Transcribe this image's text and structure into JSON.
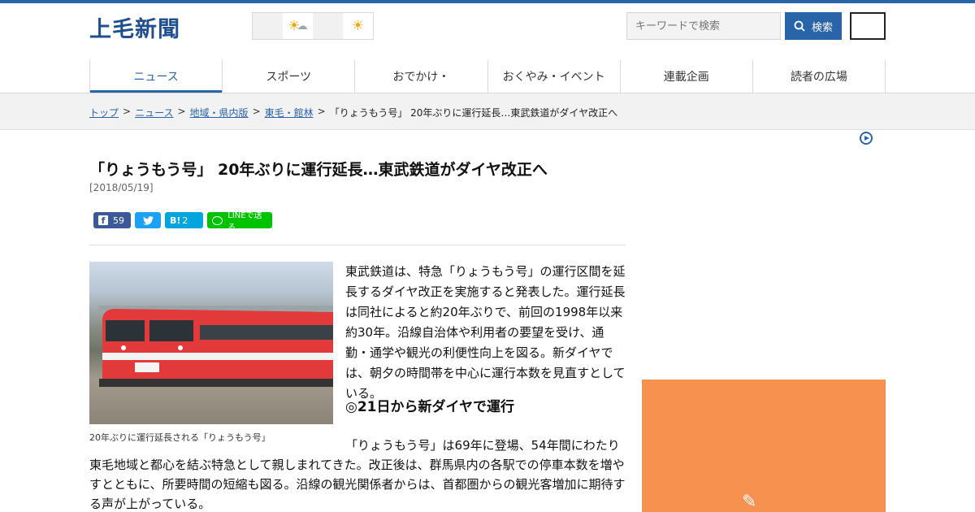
{
  "header": {
    "logo": "上毛新聞",
    "search_placeholder": "キーワードで検索",
    "search_label": "検索"
  },
  "weather": {
    "today_icon": "sun-cloud-icon",
    "tomorrow_icon": "sun-icon"
  },
  "nav": [
    {
      "label": "ニュース",
      "active": true
    },
    {
      "label": "スポーツ",
      "active": false
    },
    {
      "label": "おでかけ・",
      "active": false
    },
    {
      "label": "おくやみ・イベント",
      "active": false
    },
    {
      "label": "連載企画",
      "active": false
    },
    {
      "label": "読者の広場",
      "active": false
    }
  ],
  "breadcrumb": {
    "items": [
      "トップ",
      "ニュース",
      "地域・県内版",
      "東毛・館林"
    ],
    "current": "「りょうもう号」 20年ぶりに運行延長…東武鉄道がダイヤ改正へ"
  },
  "article": {
    "title": "「りょうもう号」 20年ぶりに運行延長…東武鉄道がダイヤ改正へ",
    "date": "[2018/05/19]",
    "share": {
      "facebook_count": "59",
      "hatena_label": "B!",
      "hatena_count": "2",
      "line_label": "LINEで送る"
    },
    "photo_caption": "20年ぶりに運行延長される「りょうもう号」",
    "paragraph1": "東武鉄道は、特急「りょうもう号」の運行区間を延長するダイヤ改正を実施すると発表した。運行延長は同社によると約20年ぶりで、前回の1998年以来約30年。沿線自治体や利用者の要望を受け、通勤・通学や観光の利便性向上を図る。新ダイヤでは、朝夕の時間帯を中心に運行本数を見直すとしている。",
    "subhead": "◎21日から新ダイヤで運行",
    "paragraph2": "「りょうもう号」は69年に登場、54年間にわたり東毛地域と都心を結ぶ特急として親しまれてきた。改正後は、群馬県内の各駅での停車本数を増やすとともに、所要時間の短縮も図る。沿線の観光関係者からは、首都圏からの観光客増加に期待する声が上がっている。"
  }
}
